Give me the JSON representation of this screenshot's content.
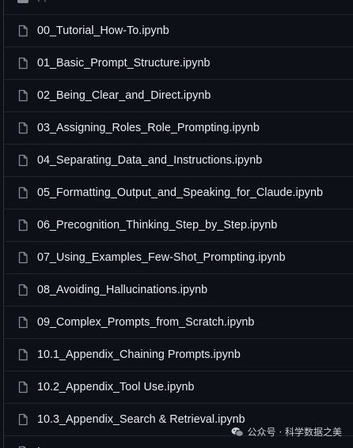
{
  "listing": {
    "parent_label": ". .",
    "files": [
      {
        "name": "00_Tutorial_How-To.ipynb"
      },
      {
        "name": "01_Basic_Prompt_Structure.ipynb"
      },
      {
        "name": "02_Being_Clear_and_Direct.ipynb"
      },
      {
        "name": "03_Assigning_Roles_Role_Prompting.ipynb"
      },
      {
        "name": "04_Separating_Data_and_Instructions.ipynb"
      },
      {
        "name": "05_Formatting_Output_and_Speaking_for_Claude.ipynb"
      },
      {
        "name": "06_Precognition_Thinking_Step_by_Step.ipynb"
      },
      {
        "name": "07_Using_Examples_Few-Shot_Prompting.ipynb"
      },
      {
        "name": "08_Avoiding_Hallucinations.ipynb"
      },
      {
        "name": "09_Complex_Prompts_from_Scratch.ipynb"
      },
      {
        "name": "10.1_Appendix_Chaining Prompts.ipynb"
      },
      {
        "name": "10.2_Appendix_Tool Use.ipynb"
      },
      {
        "name": "10.3_Appendix_Search & Retrieval.ipynb"
      }
    ],
    "trailing_partial_label": "L"
  },
  "watermark": {
    "text": "公众号 · 科学数据之美"
  },
  "colors": {
    "background": "#0d1117",
    "text": "#e6edf3",
    "icon": "#848d97",
    "divider": "#21262d"
  },
  "icons": {
    "file": "file-icon",
    "folder": "folder-icon",
    "watermark": "wechat-icon"
  }
}
